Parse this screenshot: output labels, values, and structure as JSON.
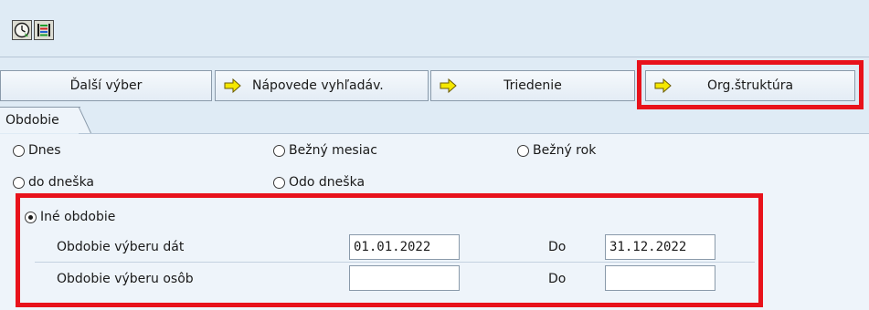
{
  "toolbar": {
    "icons": [
      "execute-clock-icon",
      "selection-options-icon"
    ]
  },
  "buttons": {
    "more_selection": "Ďalší výber",
    "search_help": "Nápovede vyhľadáv.",
    "sorting": "Triedenie",
    "org_structure": "Org.štruktúra"
  },
  "tab": {
    "label": "Obdobie"
  },
  "period": {
    "options": {
      "today": "Dnes",
      "current_month": "Bežný mesiac",
      "current_year": "Bežný rok",
      "up_to_today": "do dneška",
      "from_today": "Odo dneška",
      "other_period": "Iné obdobie"
    },
    "selected": "other_period",
    "data_selection": {
      "label": "Obdobie výberu dát",
      "from": "01.01.2022",
      "to_label": "Do",
      "to": "31.12.2022"
    },
    "person_selection": {
      "label": "Obdobie výberu osôb",
      "from": "",
      "to_label": "Do",
      "to": ""
    }
  },
  "colors": {
    "highlight": "#e8121b",
    "background": "#dfebf5",
    "panel": "#eef4fa"
  }
}
